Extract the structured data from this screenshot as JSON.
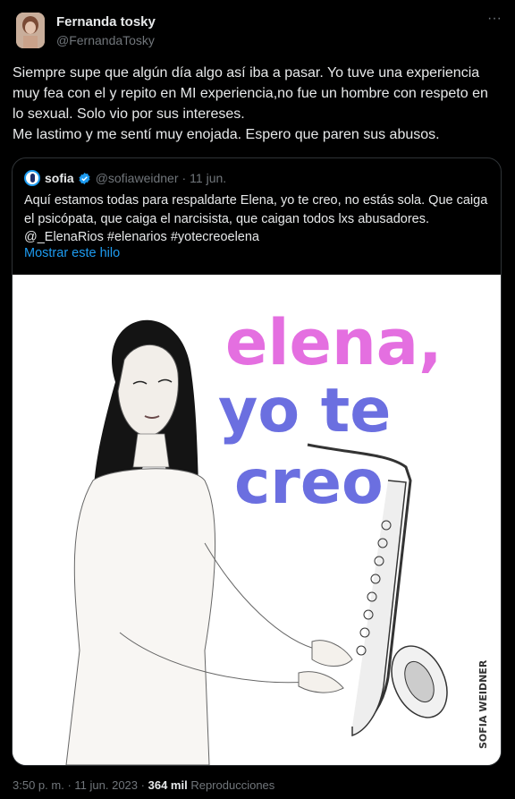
{
  "author": {
    "name": "Fernanda tosky",
    "handle": "@FernandaTosky"
  },
  "more_label": "···",
  "tweet": {
    "lines": [
      "Siempre supe que algún día algo así iba a pasar. Yo tuve una experiencia muy fea con el y repito en MI experiencia,no fue un hombre con respeto en lo sexual. Solo vio por sus intereses.",
      "Me lastimo y me sentí muy enojada. Espero que paren sus abusos."
    ]
  },
  "quote": {
    "name": "sofia",
    "handle": "@sofiaweidner",
    "separator": "·",
    "date": "11 jun.",
    "text": "Aquí estamos todas para respaldarte Elena, yo te creo, no estás sola. Que caiga el psicópata, que caiga el narcisista, que caigan todos lxs abusadores. @_ElenaRios #elenarios #yotecreoelena",
    "show_thread": "Mostrar este hilo",
    "image": {
      "line1": "elena,",
      "line2": "yo te",
      "line3": "creo",
      "signature": "SOFIA WEIDNER",
      "colors": {
        "pink": "#e46fe0",
        "blue": "#6b6fe0"
      }
    }
  },
  "footer": {
    "time": "3:50 p. m.",
    "separator": "·",
    "date": "11 jun. 2023",
    "views": "364 mil",
    "views_label": "Reproducciones"
  }
}
